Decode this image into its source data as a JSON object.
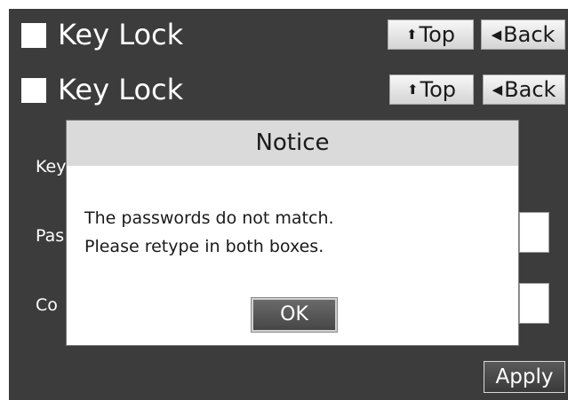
{
  "header_primary": {
    "title": "Key Lock",
    "top_button": {
      "icon": "up-arrow-icon",
      "label": "Top"
    },
    "back_button": {
      "icon": "left-triangle-icon",
      "label": "Back"
    }
  },
  "header_secondary": {
    "title": "Key Lock",
    "top_button": {
      "icon": "up-arrow-icon",
      "label": "Top"
    },
    "back_button": {
      "icon": "left-triangle-icon",
      "label": "Back"
    }
  },
  "form": {
    "key_label": "Key",
    "password_label": "Pas",
    "confirm_label": "Co",
    "apply_label": "Apply"
  },
  "dialog": {
    "title": "Notice",
    "line_1": "The passwords do not match.",
    "line_2": "Please retype in both boxes.",
    "ok_label": "OK"
  },
  "colors": {
    "background": "#3c3c3c",
    "dialog_title_bar": "#dadada",
    "text_light": "#ffffff",
    "text_dark": "#1a1a1a"
  }
}
